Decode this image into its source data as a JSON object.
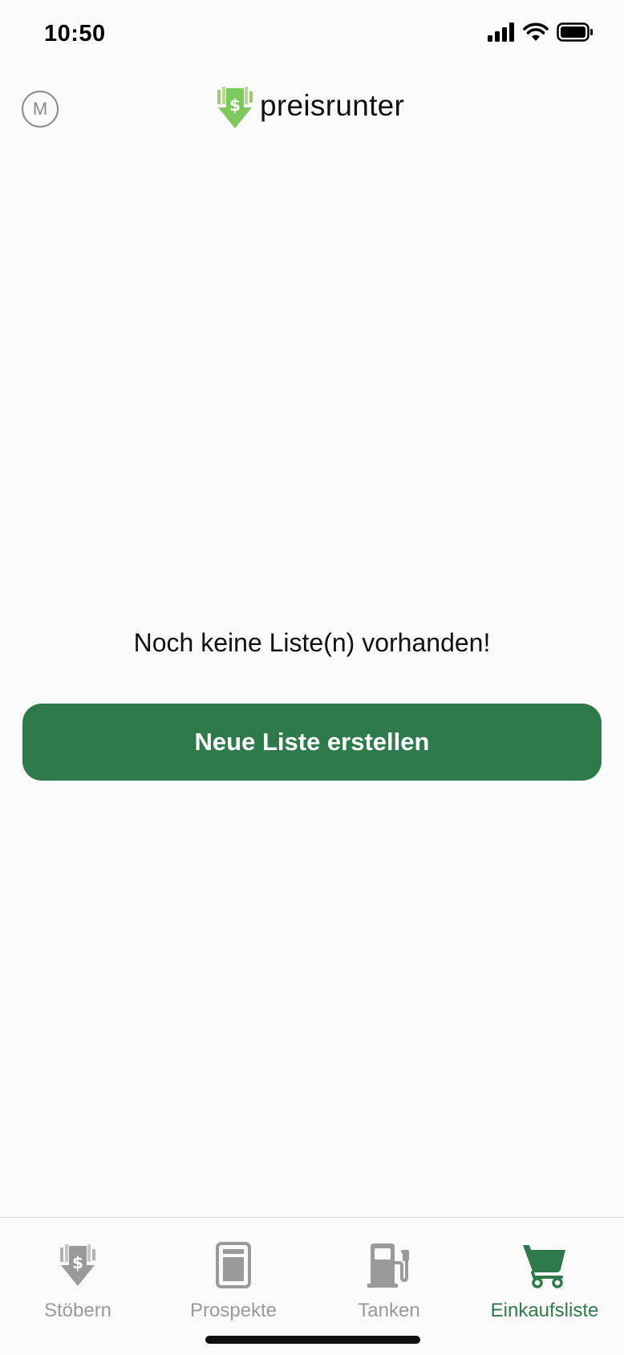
{
  "status_bar": {
    "time": "10:50"
  },
  "header": {
    "avatar_initial": "M",
    "brand_name": "preisrunter"
  },
  "empty_state": {
    "message": "Noch keine Liste(n) vorhanden!",
    "button_label": "Neue Liste erstellen"
  },
  "tabs": [
    {
      "label": "Stöbern",
      "icon": "price-down-icon",
      "active": false
    },
    {
      "label": "Prospekte",
      "icon": "brochure-icon",
      "active": false
    },
    {
      "label": "Tanken",
      "icon": "fuel-pump-icon",
      "active": false
    },
    {
      "label": "Einkaufsliste",
      "icon": "cart-icon",
      "active": true
    }
  ],
  "colors": {
    "accent": "#2f7a4a",
    "logo_green": "#7dc95e",
    "inactive": "#9a9a9a",
    "background": "#fafafa"
  }
}
